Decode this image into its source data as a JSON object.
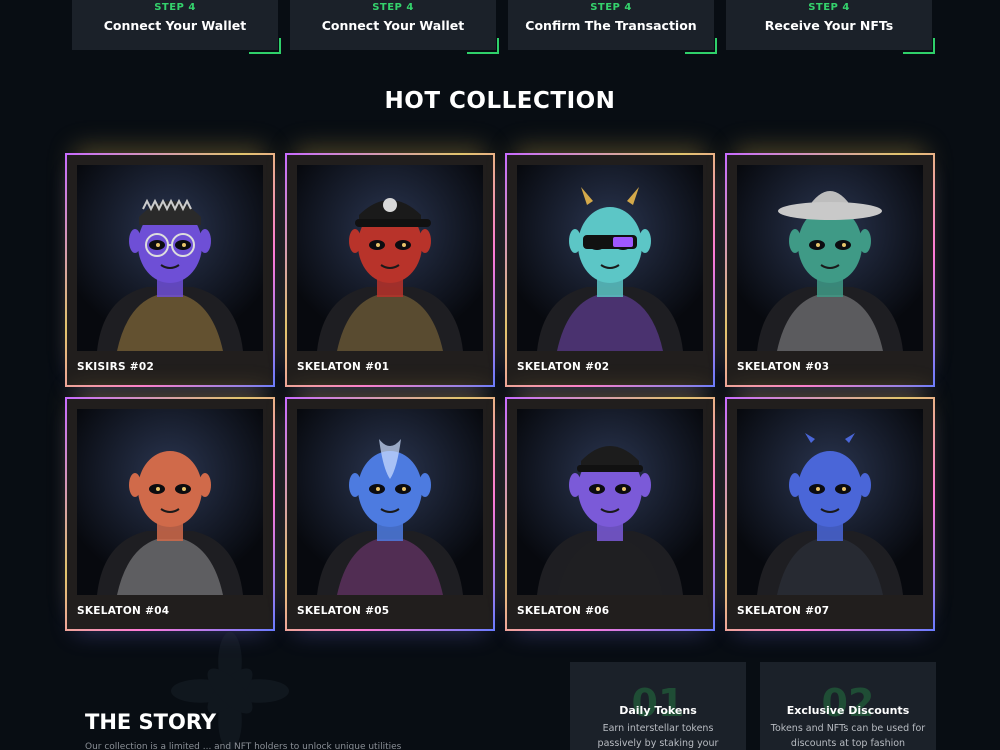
{
  "steps": [
    {
      "num": "STEP 4",
      "title": "Connect Your Wallet"
    },
    {
      "num": "STEP 4",
      "title": "Connect Your Wallet"
    },
    {
      "num": "STEP 4",
      "title": "Confirm The Transaction"
    },
    {
      "num": "STEP 4",
      "title": "Receive Your NFTs"
    }
  ],
  "colors": {
    "accent": "#34d26c",
    "background": "#080d13",
    "card": "#211e1d"
  },
  "collection": {
    "title": "HOT COLLECTION",
    "items": [
      {
        "name": "SKISIRS #02",
        "skin": "#6e4fd6",
        "accent": "#e6b34a",
        "icon": "alien-with-glasses-image"
      },
      {
        "name": "SKELATON #01",
        "skin": "#b8332a",
        "accent": "#c9a04a",
        "icon": "alien-with-cap-image"
      },
      {
        "name": "SKELATON #02",
        "skin": "#5cc6c6",
        "accent": "#9e58ff",
        "icon": "alien-with-horns-image"
      },
      {
        "name": "SKELATON #03",
        "skin": "#3f9a86",
        "accent": "#cfcfcf",
        "icon": "alien-with-cowboy-hat-image"
      },
      {
        "name": "SKELATON #04",
        "skin": "#d06a4a",
        "accent": "#d6d6d6",
        "icon": "alien-in-silver-jacket-image"
      },
      {
        "name": "SKELATON #05",
        "skin": "#4d7be0",
        "accent": "#b24bb0",
        "icon": "alien-in-white-suit-image"
      },
      {
        "name": "SKELATON #06",
        "skin": "#7b5ad8",
        "accent": "#222222",
        "icon": "alien-with-black-cap-image"
      },
      {
        "name": "SKELATON #07",
        "skin": "#4a66d8",
        "accent": "#3a4150",
        "icon": "alien-in-camo-image"
      }
    ]
  },
  "story": {
    "title": "THE STORY",
    "text": "Our collection is a limited ... and NFT holders to unlock unique utilities"
  },
  "features": [
    {
      "num": "01",
      "title": "Daily Tokens",
      "desc": "Earn interstellar tokens passively by staking your"
    },
    {
      "num": "02",
      "title": "Exclusive Discounts",
      "desc": "Tokens and NFTs can be used for discounts at top fashion"
    }
  ]
}
